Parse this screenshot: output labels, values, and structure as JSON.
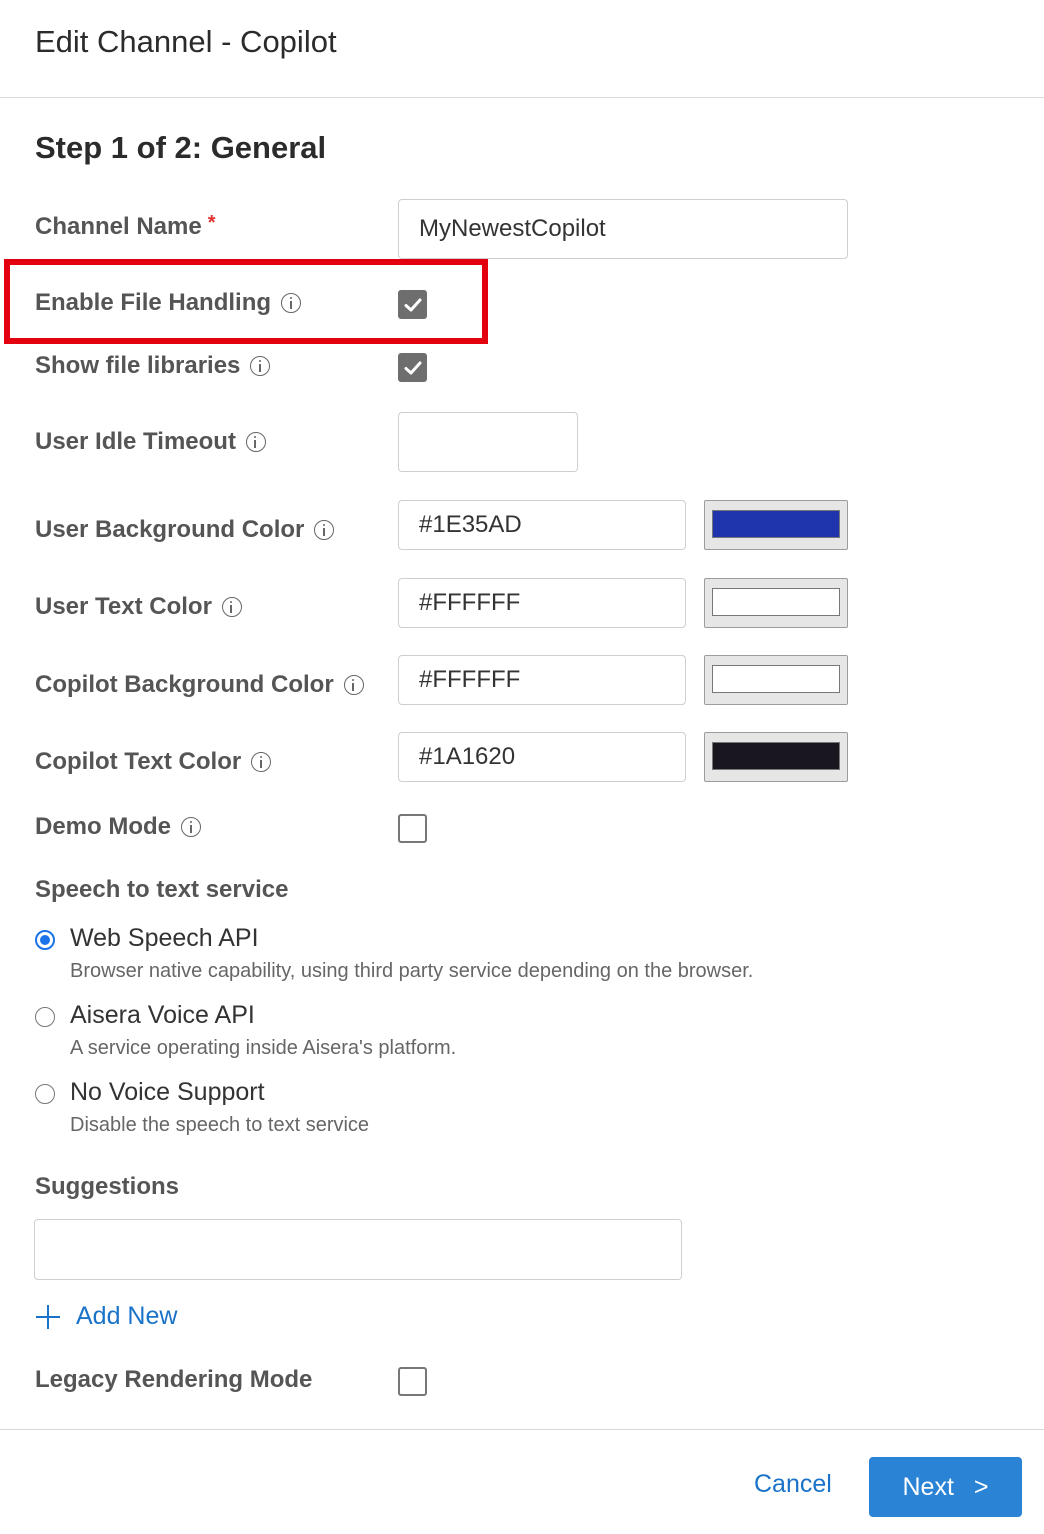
{
  "header": {
    "title": "Edit Channel - Copilot"
  },
  "step": {
    "title": "Step 1 of 2: General"
  },
  "form": {
    "channel_name": {
      "label": "Channel Name",
      "required_mark": "*",
      "value": "MyNewestCopilot"
    },
    "enable_file_handling": {
      "label": "Enable File Handling",
      "checked": true
    },
    "show_file_libraries": {
      "label": "Show file libraries",
      "checked": true
    },
    "user_idle_timeout": {
      "label": "User Idle Timeout",
      "value": ""
    },
    "user_background_color": {
      "label": "User Background Color",
      "value": "#1E35AD",
      "swatch": "#1E35AD"
    },
    "user_text_color": {
      "label": "User Text Color",
      "value": "#FFFFFF",
      "swatch": "#FFFFFF"
    },
    "copilot_background_color": {
      "label": "Copilot Background Color",
      "value": "#FFFFFF",
      "swatch": "#FFFFFF"
    },
    "copilot_text_color": {
      "label": "Copilot Text Color",
      "value": "#1A1620",
      "swatch": "#1A1620"
    },
    "demo_mode": {
      "label": "Demo Mode",
      "checked": false
    }
  },
  "speech": {
    "label": "Speech to text service",
    "options": [
      {
        "title": "Web Speech API",
        "description": "Browser native capability, using third party service depending on the browser.",
        "selected": true
      },
      {
        "title": "Aisera Voice API",
        "description": "A service operating inside Aisera's platform.",
        "selected": false
      },
      {
        "title": "No Voice Support",
        "description": "Disable the speech to text service",
        "selected": false
      }
    ]
  },
  "suggestions": {
    "label": "Suggestions",
    "value": "",
    "add_label": "Add New"
  },
  "legacy_rendering": {
    "label": "Legacy Rendering Mode",
    "checked": false
  },
  "footer": {
    "cancel_label": "Cancel",
    "next_label": "Next",
    "next_chevron": ">"
  },
  "colors": {
    "accent": "#2B83D6",
    "link": "#1A73C8",
    "highlight": "#E3000F"
  }
}
